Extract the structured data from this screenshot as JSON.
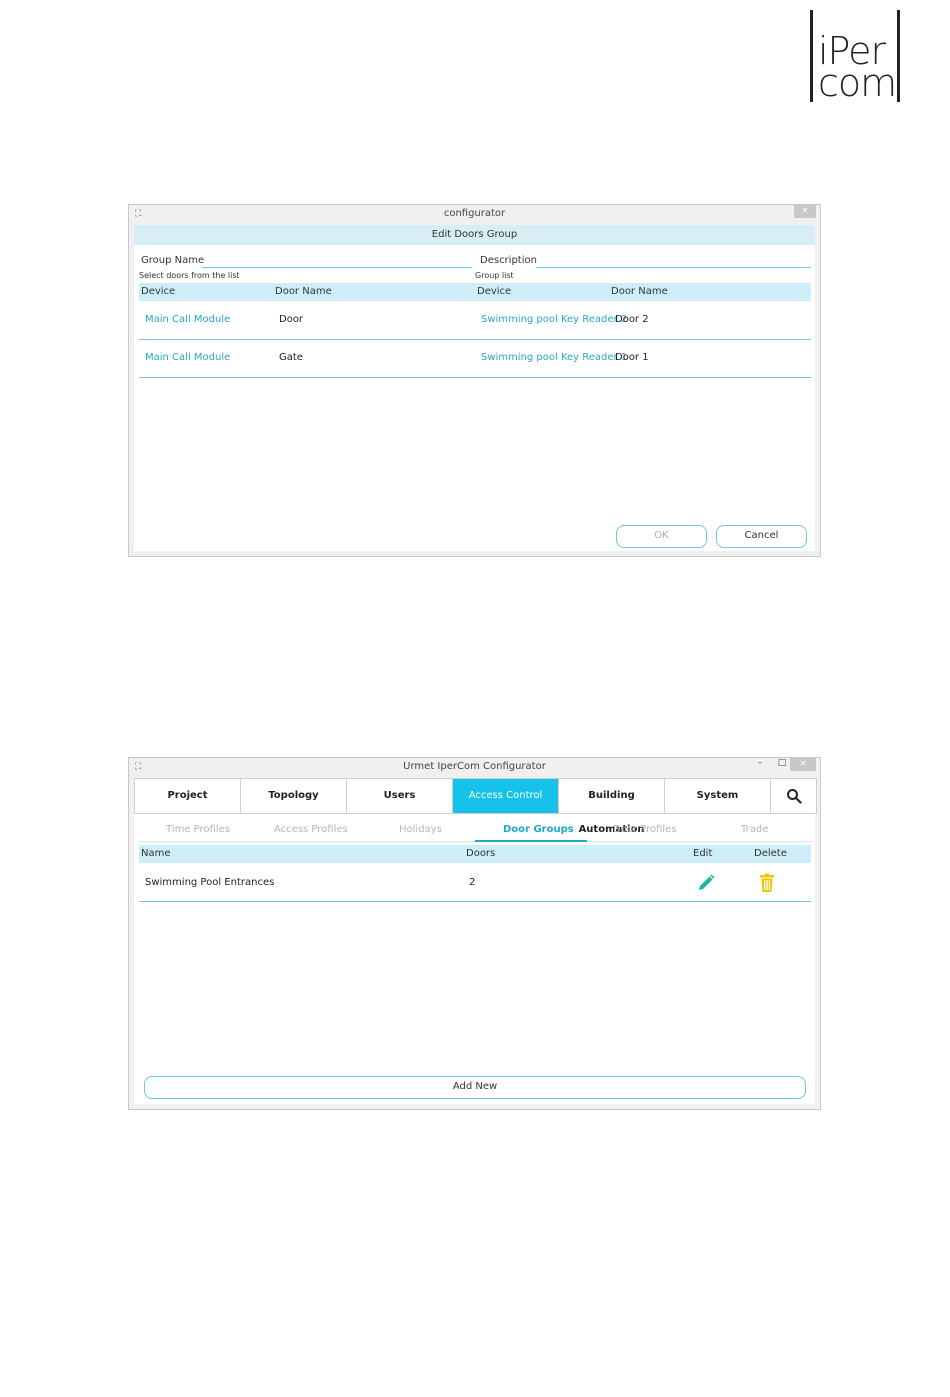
{
  "logo": {
    "line1": "iPer",
    "line2": "com"
  },
  "dialog": {
    "window_title": "configurator",
    "close_glyph": "×",
    "header": "Edit Doors Group",
    "group_name_label": "Group Name",
    "description_label": "Description",
    "select_doors_label": "Select doors from the list",
    "group_list_label": "Group list",
    "left_columns": [
      "Device",
      "Door Name"
    ],
    "right_columns": [
      "Device",
      "Door Name"
    ],
    "left_rows": [
      {
        "device": "Main Call Module",
        "door": "Door"
      },
      {
        "device": "Main Call Module",
        "door": "Gate"
      }
    ],
    "right_rows": [
      {
        "device": "Swimming pool Key Reader 2",
        "door": "Door 2"
      },
      {
        "device": "Swimming pool Key Reader 1",
        "door": "Door 1"
      }
    ],
    "ok_label": "OK",
    "cancel_label": "Cancel"
  },
  "app": {
    "window_title": "Urmet IperCom Configurator",
    "minimize_glyph": "–",
    "maximize_glyph": "□",
    "close_glyph": "×",
    "tabs": [
      "Project",
      "Topology",
      "Users",
      "Access Control",
      "Building Automation",
      "System"
    ],
    "active_tab": "Access Control",
    "sub_tabs": [
      "Time Profiles",
      "Access Profiles",
      "Holidays",
      "Door Groups",
      "Door Profiles",
      "Trade"
    ],
    "active_sub_tab": "Door Groups",
    "columns": {
      "name": "Name",
      "doors": "Doors",
      "edit": "Edit",
      "delete": "Delete"
    },
    "rows": [
      {
        "name": "Swimming Pool Entrances",
        "doors": "2"
      }
    ],
    "add_new_label": "Add New",
    "colors": {
      "accent": "#16c2ea",
      "edit_icon": "#19b99a",
      "delete_icon": "#f2c400"
    },
    "icons": {
      "search": "search-icon",
      "edit": "pencil-icon",
      "delete": "trash-icon"
    }
  }
}
